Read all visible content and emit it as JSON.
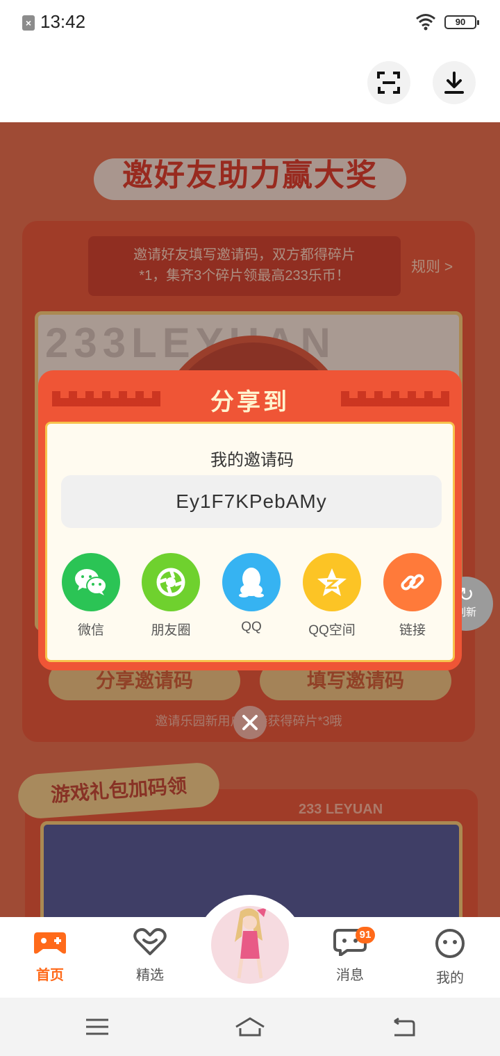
{
  "status_bar": {
    "time": "13:42",
    "battery": "90"
  },
  "page": {
    "hero_title": "邀好友助力赢大奖",
    "banner_line1": "邀请好友填写邀请码，双方都得碎片",
    "banner_line2": "*1，集齐3个碎片领最高233乐币！",
    "rule_link": "规则 >",
    "watermark": "233LEYUAN",
    "share_code_button": "分享邀请码",
    "fill_code_button": "填写邀请码",
    "invite_note": "邀请乐园新用户直接获得碎片*3哦",
    "refresh_label": "刷新",
    "gift_ribbon": "游戏礼包加码领",
    "leyuan_text": "233 LEYUAN"
  },
  "dialog": {
    "title": "分享到",
    "code_label": "我的邀请码",
    "invite_code": "Ey1F7KPebAMy",
    "share_targets": [
      {
        "name": "微信",
        "icon": "wechat-icon",
        "color": "#2bc455"
      },
      {
        "name": "朋友圈",
        "icon": "moments-icon",
        "color": "#6fd12e"
      },
      {
        "name": "QQ",
        "icon": "qq-icon",
        "color": "#36b3f2"
      },
      {
        "name": "QQ空间",
        "icon": "qzone-icon",
        "color": "#fcc425"
      },
      {
        "name": "链接",
        "icon": "link-icon",
        "color": "#ff7a3a"
      }
    ]
  },
  "bottom_nav": {
    "items": [
      {
        "label": "首页",
        "icon": "home-gamepad-icon",
        "active": true
      },
      {
        "label": "精选",
        "icon": "featured-heart-icon",
        "active": false
      },
      {
        "label": "消息",
        "icon": "message-icon",
        "active": false,
        "badge": "91"
      },
      {
        "label": "我的",
        "icon": "profile-icon",
        "active": false
      }
    ]
  },
  "colors": {
    "accent": "#ff6a1a",
    "dialog": "#ef5536",
    "border_gold": "#f7c24d"
  }
}
